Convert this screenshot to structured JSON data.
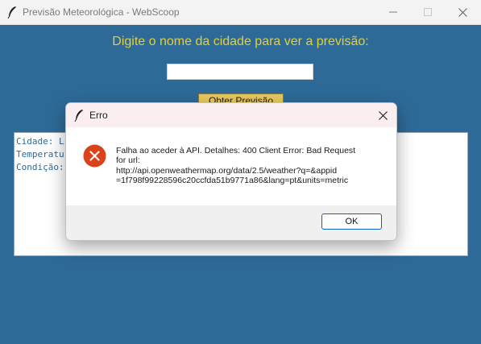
{
  "window": {
    "title": "Previsão Meteorológica - WebScoop",
    "icons": [
      "feather-icon",
      "minimize-icon",
      "maximize-icon",
      "close-icon"
    ]
  },
  "main": {
    "prompt": "Digite o nome da cidade para ver a previsão:",
    "city_input_value": "",
    "search_button_label": "Obter Previsão",
    "output_lines": [
      "Cidade: L",
      "Temperatu",
      "Condição:"
    ],
    "colors": {
      "background": "#2e6a98",
      "prompt": "#e6cf36",
      "button": "#e6c95c"
    }
  },
  "dialog": {
    "title": "Erro",
    "icon": "error-icon",
    "message_lines": [
      "Falha ao aceder à API. Detalhes: 400 Client Error: Bad Request",
      "for url:",
      "http://api.openweathermap.org/data/2.5/weather?q=&appid",
      "=1f798f99228596c20ccfda51b9771a86&lang=pt&units=metric"
    ],
    "ok_label": "OK",
    "colors": {
      "error": "#d9421b",
      "accent": "#0a64c4"
    }
  }
}
